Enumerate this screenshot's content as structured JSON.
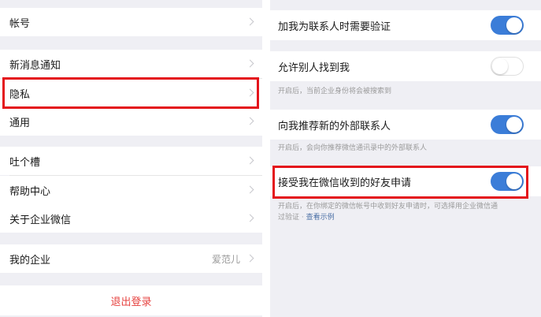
{
  "left_menu": {
    "account": "帐号",
    "new_message_notify": "新消息通知",
    "privacy": "隐私",
    "general": "通用",
    "feedback": "吐个槽",
    "help_center": "帮助中心",
    "about": "关于企业微信",
    "my_company": "我的企业",
    "my_company_value": "爱范儿",
    "logout": "退出登录"
  },
  "right_settings": {
    "require_verification": {
      "label": "加我为联系人时需要验证",
      "enabled": true
    },
    "allow_find_me": {
      "label": "允许别人找到我",
      "enabled": false,
      "hint": "开启后，当前企业身份将会被搜索到"
    },
    "recommend_external": {
      "label": "向我推荐新的外部联系人",
      "enabled": true,
      "hint": "开启后，会向你推荐微信通讯录中的外部联系人"
    },
    "accept_wechat_requests": {
      "label": "接受我在微信收到的好友申请",
      "enabled": true,
      "hint_line1": "开启后，在你绑定的微信帐号中收到好友申请时，可选择用企业微信通",
      "hint_line2_prefix": "过验证 · ",
      "hint_link": "查看示例"
    }
  },
  "colors": {
    "accent_blue": "#3b7dd8",
    "highlight_red": "#e4141b",
    "logout_red": "#e64340",
    "background_gray": "#efeff4"
  }
}
